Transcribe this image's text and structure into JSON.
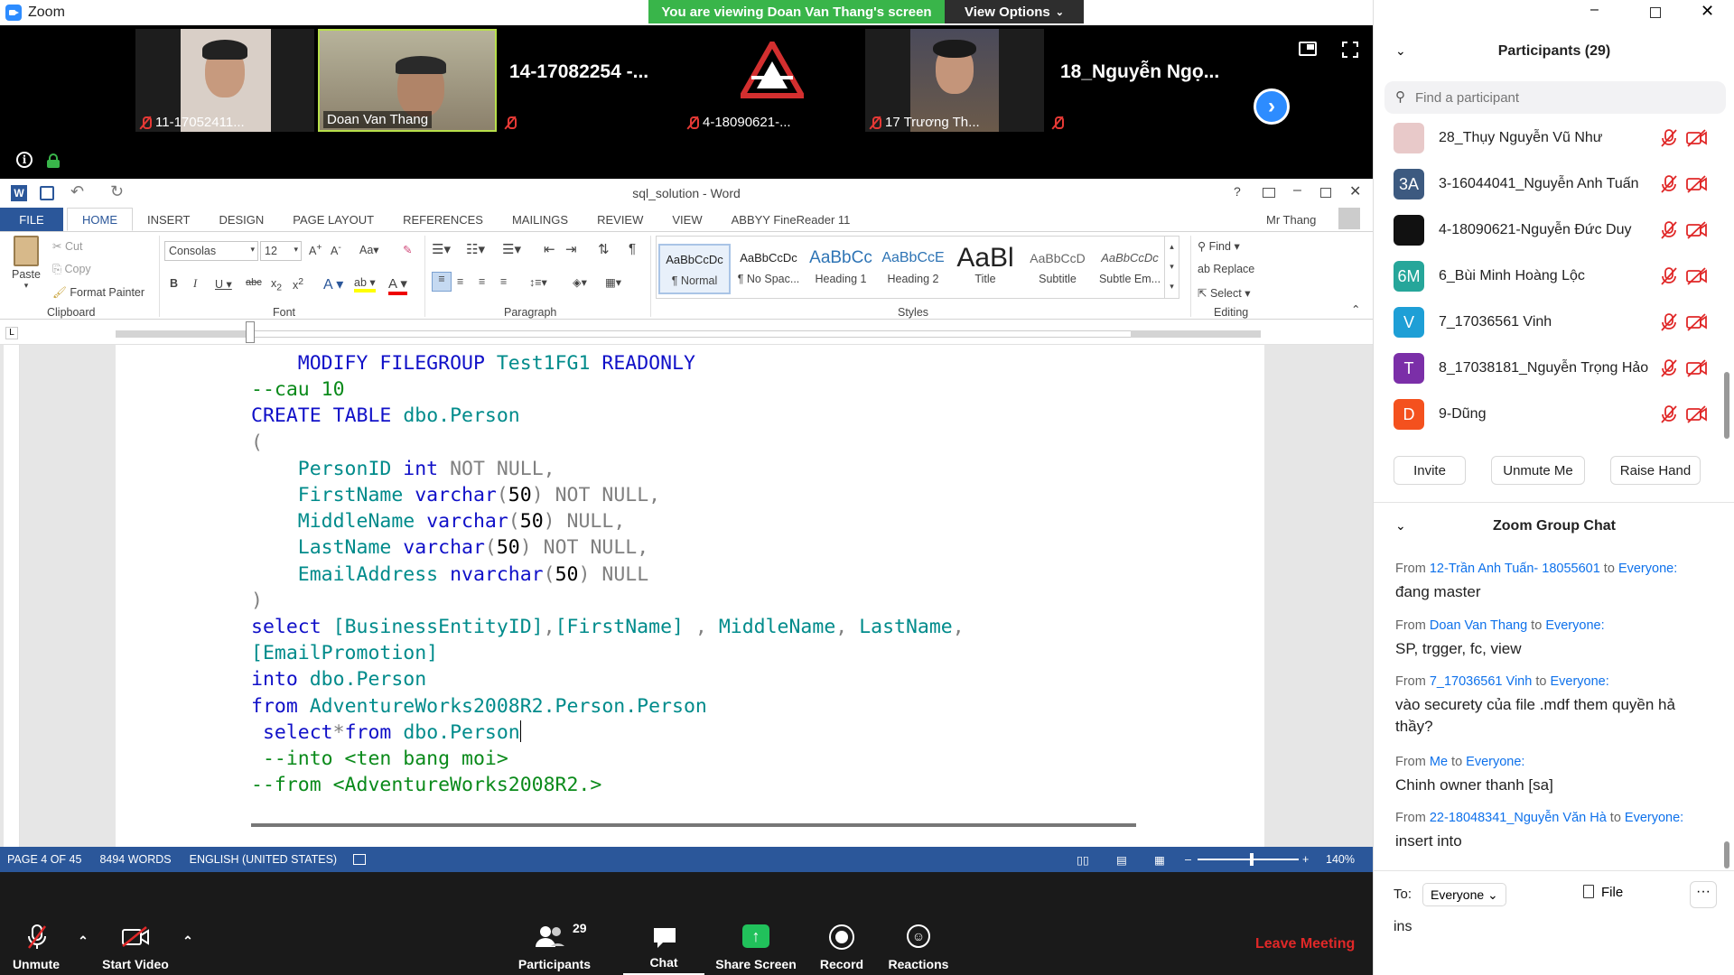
{
  "app": {
    "title": "Zoom",
    "viewing_banner": "You are viewing Doan Van Thang's screen",
    "view_options": "View Options"
  },
  "video_tiles": [
    {
      "name": "11-17052411..."
    },
    {
      "name": "Doan Van Thang"
    },
    {
      "name": "14-17082254 -..."
    },
    {
      "name": "4-18090621-..."
    },
    {
      "name": "17 Trương Th..."
    },
    {
      "name": "18_Nguyễn Ngọ..."
    }
  ],
  "word": {
    "doc_title": "sql_solution - Word",
    "user": "Mr Thang",
    "tabs": [
      "HOME",
      "INSERT",
      "DESIGN",
      "PAGE LAYOUT",
      "REFERENCES",
      "MAILINGS",
      "REVIEW",
      "VIEW",
      "ABBYY FineReader 11"
    ],
    "file_tab": "FILE",
    "clipboard": {
      "paste": "Paste",
      "cut": "Cut",
      "copy": "Copy",
      "format_painter": "Format Painter",
      "label": "Clipboard"
    },
    "font": {
      "name": "Consolas",
      "size": "12",
      "label": "Font"
    },
    "paragraph_label": "Paragraph",
    "styles": [
      {
        "preview": "AaBbCcDc",
        "label": "¶ Normal"
      },
      {
        "preview": "AaBbCcDc",
        "label": "¶ No Spac..."
      },
      {
        "preview": "AaBbCc",
        "label": "Heading 1"
      },
      {
        "preview": "AaBbCcE",
        "label": "Heading 2"
      },
      {
        "preview": "AaBl",
        "label": "Title"
      },
      {
        "preview": "AaBbCcD",
        "label": "Subtitle"
      },
      {
        "preview": "AaBbCcDc",
        "label": "Subtle Em..."
      }
    ],
    "styles_label": "Styles",
    "editing": {
      "find": "Find",
      "replace": "Replace",
      "select": "Select",
      "label": "Editing"
    },
    "code_lines": [
      "    MODIFY FILEGROUP Test1FG1 READONLY",
      "--cau 10",
      "CREATE TABLE dbo.Person",
      "(",
      "    PersonID int NOT NULL,",
      "    FirstName varchar(50) NOT NULL,",
      "    MiddleName varchar(50) NULL,",
      "    LastName varchar(50) NOT NULL,",
      "    EmailAddress nvarchar(50) NULL",
      ")",
      "",
      "select [BusinessEntityID],[FirstName] , MiddleName, LastName,",
      "[EmailPromotion]",
      "into dbo.Person",
      "from AdventureWorks2008R2.Person.Person",
      " select*from dbo.Person",
      " --into <ten bang moi>",
      "--from <AdventureWorks2008R2.>"
    ],
    "status": {
      "page": "PAGE 4 OF 45",
      "words": "8494 WORDS",
      "language": "ENGLISH (UNITED STATES)",
      "zoom": "140%"
    }
  },
  "toolbar": {
    "unmute": "Unmute",
    "start_video": "Start Video",
    "participants": "Participants",
    "participants_count": "29",
    "chat": "Chat",
    "share_screen": "Share Screen",
    "record": "Record",
    "reactions": "Reactions",
    "leave": "Leave Meeting"
  },
  "participants_panel": {
    "title": "Participants (29)",
    "search_placeholder": "Find a participant",
    "list": [
      {
        "name": "28_Thụy Nguyễn Vũ Như",
        "avatar": "",
        "color": "#e8c9c9"
      },
      {
        "name": "3-16044041_Nguyễn Anh Tuấn",
        "avatar": "3A",
        "color": "#3d5a80"
      },
      {
        "name": "4-18090621-Nguyễn Đức Duy",
        "avatar": "",
        "color": "#111111"
      },
      {
        "name": "6_Bùi Minh Hoàng Lộc",
        "avatar": "6M",
        "color": "#26a69a"
      },
      {
        "name": "7_17036561 Vinh",
        "avatar": "V",
        "color": "#1e9fd6"
      },
      {
        "name": "8_17038181_Nguyễn Trọng Hảo",
        "avatar": "T",
        "color": "#7b2fa8"
      },
      {
        "name": "9-Dũng",
        "avatar": "D",
        "color": "#f4511e"
      }
    ],
    "invite": "Invite",
    "unmute_me": "Unmute Me",
    "raise_hand": "Raise Hand"
  },
  "chat": {
    "title": "Zoom Group Chat",
    "messages": [
      {
        "from": "12-Trần Anh Tuấn- 18055601",
        "to": "Everyone",
        "text": "đang master"
      },
      {
        "from": "Doan Van Thang",
        "to": "Everyone",
        "text": "SP, trgger, fc, view"
      },
      {
        "from": "7_17036561 Vinh",
        "to": "Everyone",
        "text": "vào securety của file .mdf them quyền hả thầy?"
      },
      {
        "from": "Me",
        "to": "Everyone",
        "text": "Chinh owner thanh [sa]"
      },
      {
        "from": "22-18048341_Nguyễn Văn Hà",
        "to": "Everyone",
        "text": "insert into"
      }
    ],
    "from_word": "From",
    "to_word": "to",
    "to_label": "To:",
    "to_select": "Everyone",
    "file": "File",
    "input_value": "ins"
  }
}
